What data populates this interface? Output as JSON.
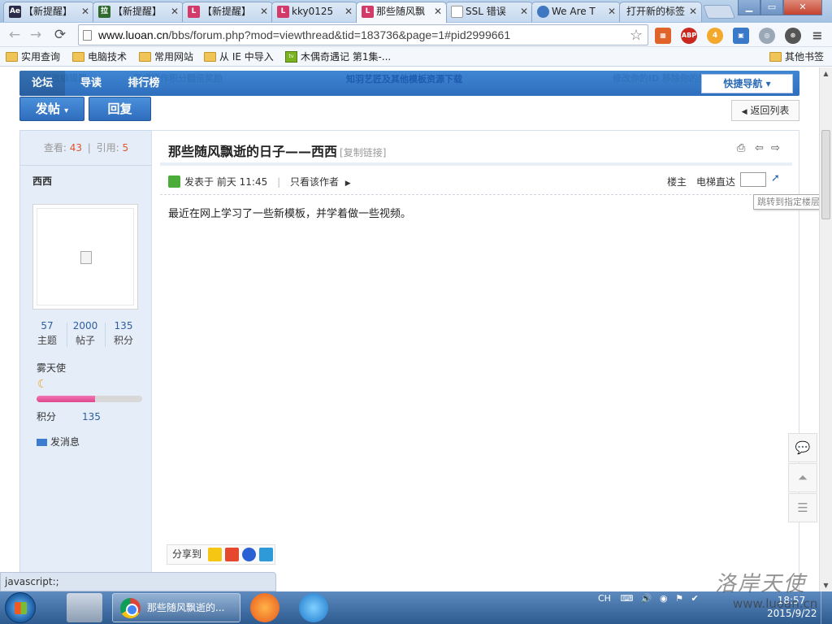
{
  "browser": {
    "tabs": [
      {
        "label": "【新提醒】",
        "fav": "Ae"
      },
      {
        "label": "【新提醒】",
        "fav": "拉"
      },
      {
        "label": "【新提醒】",
        "fav": "L"
      },
      {
        "label": "kky0125",
        "fav": "L"
      },
      {
        "label": "那些随风飘",
        "fav": "L"
      },
      {
        "label": "SSL 错误",
        "fav": ""
      },
      {
        "label": "We Are T",
        "fav": ""
      },
      {
        "label": "打开新的标签",
        "fav": ""
      }
    ],
    "url_host": "www.luoan.cn",
    "url_path": "/bbs/forum.php?mod=viewthread&tid=183736&page=1#pid2999661",
    "extensions": [
      "ABP",
      "4"
    ],
    "bookmarks": [
      "实用查询",
      "电脑技术",
      "常用网站",
      "从 IE 中导入",
      "木偶奇遇记 第1集-..."
    ],
    "other_bookmarks": "其他书签",
    "status_url": "javascript:;"
  },
  "forum": {
    "nav_tabs": [
      "论坛",
      "导读",
      "排行榜"
    ],
    "nav_ghost": [
      "修改编辑器",
      "完成操作积分翻倍奖励",
      "知羽艺匠及其他模板资源下载",
      "修改你的ID 移除你的奖励"
    ],
    "quick_nav": "快捷导航",
    "post_button": "发帖",
    "reply_button": "回复",
    "back_to_list": "返回列表",
    "views_label": "查看:",
    "views": "43",
    "replies_label": "引用:",
    "replies": "5",
    "thread_title": "那些随风飘逝的日子——西西",
    "copy_link": "[复制链接]",
    "author": "西西",
    "author_stats": [
      {
        "value": "57",
        "label": "主题"
      },
      {
        "value": "2000",
        "label": "帖子"
      },
      {
        "value": "135",
        "label": "积分"
      }
    ],
    "user_group": "雾天使",
    "upgrade_progress": 0.55,
    "credits_label": "积分",
    "credits_value": "135",
    "send_message": "发消息",
    "posted_prefix": "发表于",
    "posted_time": "前天 11:45",
    "only_author": "只看该作者",
    "floor_label": "楼主",
    "elevator_label": "电梯直达",
    "floor_tooltip": "跳转到指定楼层",
    "post_body": "最近在网上学习了一些新模板，并学着做一些视频。",
    "share_label": "分享到"
  },
  "taskbar": {
    "active_window": "那些随风飘逝的...",
    "ime": "CH",
    "time": "18:57",
    "date": "2015/9/22"
  },
  "watermark": {
    "text": "洛岸天使",
    "url": "www.luoan.cn"
  },
  "colors": {
    "forum_blue": "#3579c8",
    "accent_red": "#e2562a",
    "progress_pink": "#e0458e"
  }
}
